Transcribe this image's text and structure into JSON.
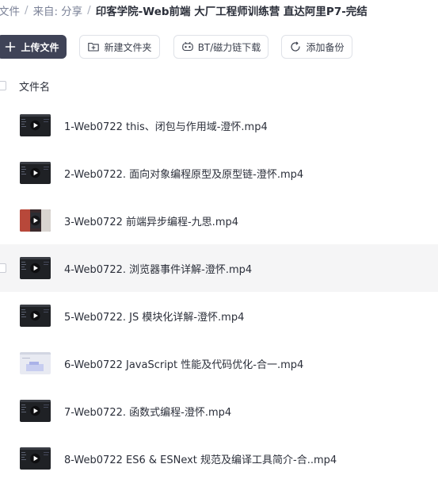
{
  "breadcrumb": {
    "root": "文件",
    "sep": "/",
    "from_label": "来自:",
    "from_value": "分享",
    "current": "印客学院-Web前端 大厂工程师训练营 直达阿里P7-完结"
  },
  "toolbar": {
    "upload": "上传文件",
    "new_folder": "新建文件夹",
    "bt_download": "BT/磁力链下载",
    "add_backup": "添加备份"
  },
  "list_header": {
    "name": "文件名"
  },
  "files": [
    {
      "name": "1-Web0722 this、闭包与作用域-澄怀.mp4",
      "thumb": "dark"
    },
    {
      "name": "2-Web0722. 面向对象编程原型及原型链-澄怀.mp4",
      "thumb": "dark"
    },
    {
      "name": "3-Web0722 前端异步编程-九思.mp4",
      "thumb": "red"
    },
    {
      "name": "4-Web0722. 浏览器事件详解-澄怀.mp4",
      "thumb": "dark",
      "hover": true
    },
    {
      "name": "5-Web0722. JS 模块化详解-澄怀.mp4",
      "thumb": "dark"
    },
    {
      "name": "6-Web0722 JavaScript 性能及代码优化-合一.mp4",
      "thumb": "light"
    },
    {
      "name": "7-Web0722. 函数式编程-澄怀.mp4",
      "thumb": "dark"
    },
    {
      "name": "8-Web0722 ES6 & ESNext 规范及编译工具简介-合..mp4",
      "thumb": "dark"
    }
  ],
  "colors": {
    "primary_button": "#3f4357",
    "text": "#2b2f3a",
    "muted": "#7c8398",
    "hover_row": "#f5f5f6"
  }
}
